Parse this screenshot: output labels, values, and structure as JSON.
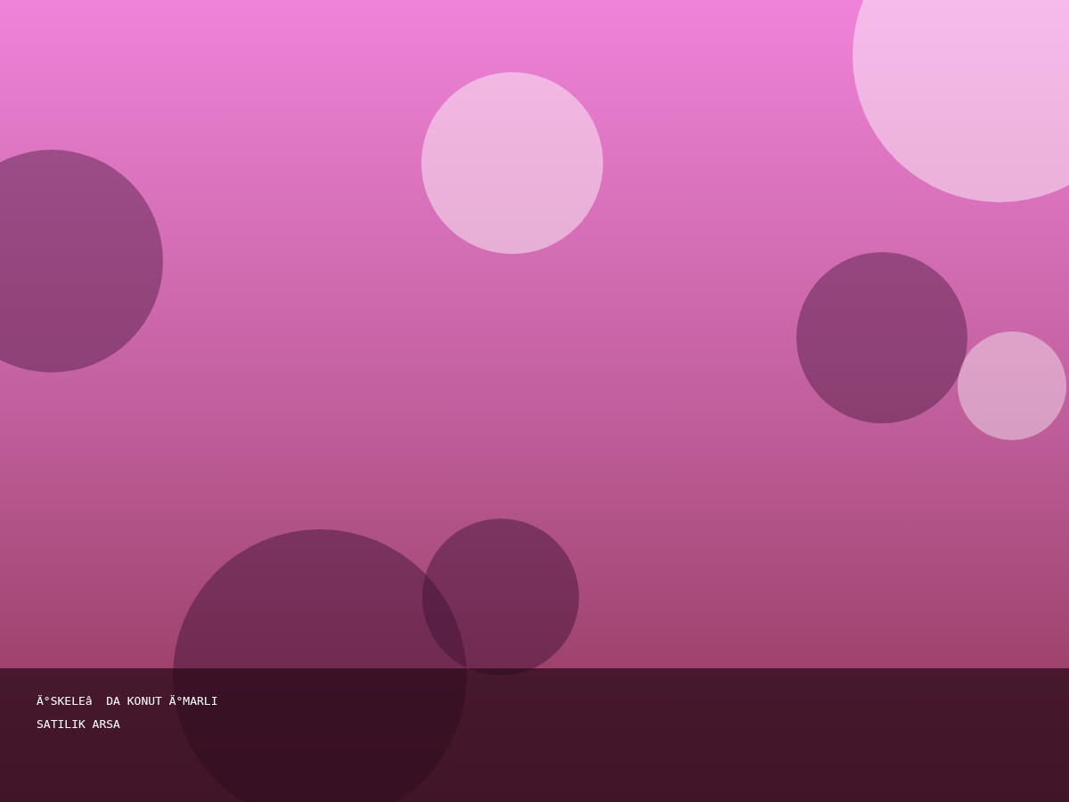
{
  "caption": {
    "lines": [
      "Ä°SKELEâ  DA KONUT Ä°MARLI",
      "SATILIK ARSA"
    ]
  }
}
